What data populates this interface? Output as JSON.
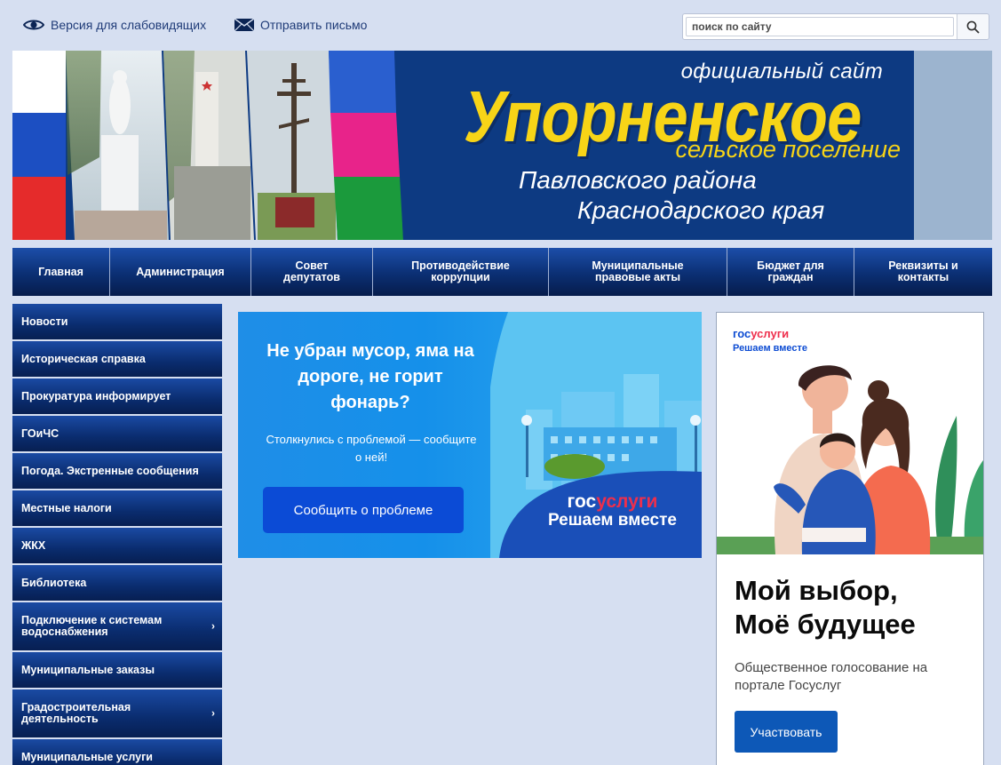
{
  "topbar": {
    "accessibility_label": "Версия для слабовидящих",
    "mail_label": "Отправить письмо",
    "search_placeholder": "поиск по сайту"
  },
  "banner": {
    "site_label": "официальный сайт",
    "name": "Упорненское",
    "settlement": "сельское поселение",
    "region_line1": "Павловского района",
    "region_line2": "Краснодарского края"
  },
  "nav": {
    "items": [
      {
        "label": "Главная"
      },
      {
        "label": "Администрация"
      },
      {
        "label": "Совет депутатов"
      },
      {
        "label": "Противодействие коррупции"
      },
      {
        "label": "Муниципальные правовые акты"
      },
      {
        "label": "Бюджет для граждан"
      },
      {
        "label": "Реквизиты и контакты"
      }
    ]
  },
  "sidebar": {
    "items": [
      {
        "label": "Новости",
        "has_submenu": false
      },
      {
        "label": "Историческая справка",
        "has_submenu": false
      },
      {
        "label": "Прокуратура информирует",
        "has_submenu": false
      },
      {
        "label": "ГОиЧС",
        "has_submenu": false
      },
      {
        "label": "Погода. Экстренные сообщения",
        "has_submenu": false
      },
      {
        "label": "Местные налоги",
        "has_submenu": false
      },
      {
        "label": "ЖКХ",
        "has_submenu": false
      },
      {
        "label": "Библиотека",
        "has_submenu": false
      },
      {
        "label": "Подключение к системам водоснабжения",
        "has_submenu": true
      },
      {
        "label": "Муниципальные заказы",
        "has_submenu": false
      },
      {
        "label": "Градостроительная деятельность",
        "has_submenu": true
      },
      {
        "label": "Муниципальные услуги",
        "has_submenu": false
      }
    ]
  },
  "promo": {
    "title": "Не убран мусор, яма на дороге, не горит фонарь?",
    "subtitle": "Столкнулись с проблемой — сообщите о ней!",
    "button_label": "Сообщить о проблеме",
    "brand_gos": "гос",
    "brand_usl": "услуги",
    "brand_tagline": "Решаем вместе"
  },
  "ad": {
    "logo_gos": "гос",
    "logo_usl": "услуги",
    "tagline": "Решаем вместе",
    "headline_line1": "Мой выбор,",
    "headline_line2": "Моё будущее",
    "description": "Общественное голосование на портале Госуслуг",
    "button_label": "Участвовать"
  },
  "colors": {
    "page_bg": "#d6dff1",
    "nav_blue": "#0b2f73",
    "banner_blue": "#0d3a82",
    "banner_yellow": "#f7d417",
    "gosuslugi_blue": "#0d4cd3",
    "gosuslugi_red": "#ee2f4c"
  }
}
